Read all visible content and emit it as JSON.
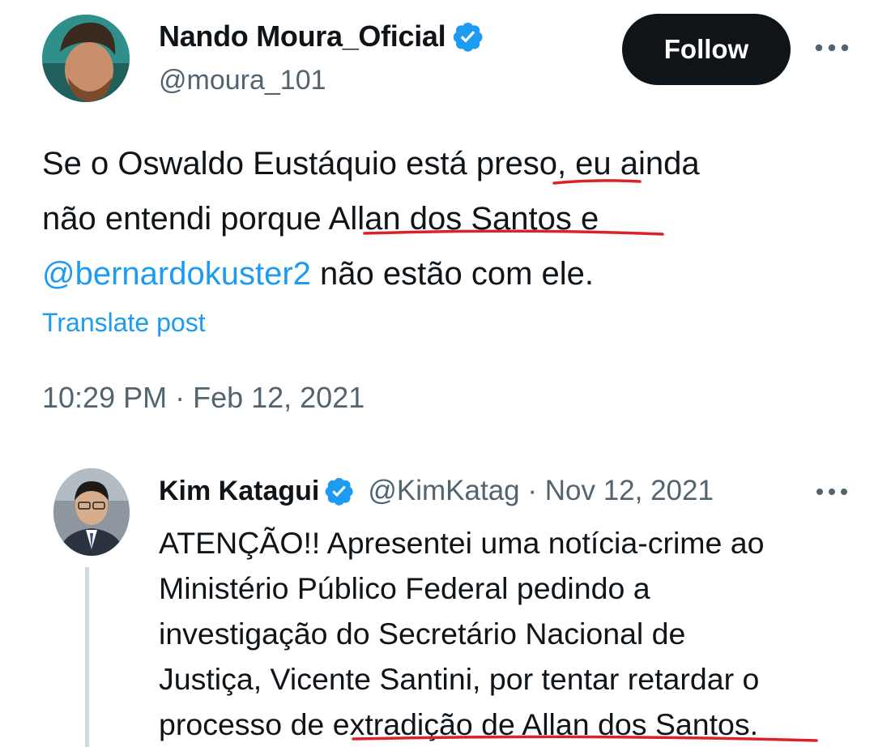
{
  "main_tweet": {
    "display_name": "Nando Moura_Oficial",
    "handle": "@moura_101",
    "follow_label": "Follow",
    "more_icon": "more-horizontal-icon",
    "text_lines": [
      [
        "Se o Oswaldo Eustáquio está ",
        "preso",
        ", eu ainda"
      ],
      [
        "não entendi porque ",
        "Allan dos Santos",
        " e"
      ],
      [
        "@bernardokuster2",
        " não estão com ele."
      ]
    ],
    "translate_label": "Translate post",
    "timestamp": "10:29 PM · Feb 12, 2021"
  },
  "quoted_tweet": {
    "display_name": "Kim Katagui",
    "meta": "@KimKatag · Nov 12, 2021",
    "more_icon": "more-horizontal-icon",
    "text_lines": [
      "ATENÇÃO!! Apresentei uma notícia-crime ao",
      "Ministério Público Federal pedindo a",
      "investigação do Secretário Nacional de",
      "Justiça, Vicente Santini, por tentar retardar o",
      "processo de extradição de Allan dos Santos."
    ]
  },
  "colors": {
    "text": "#0f1419",
    "secondary": "#536471",
    "link": "#1d9bf0",
    "verified": "#1d9bf0",
    "button_bg": "#0f1419",
    "annotation_red": "#d9232a"
  }
}
